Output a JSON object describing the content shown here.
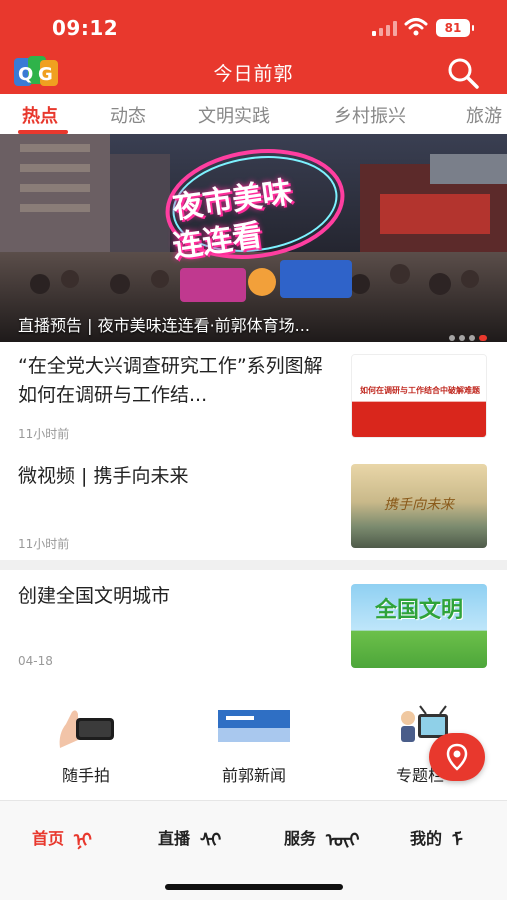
{
  "status_bar": {
    "time": "09:12",
    "battery": "81"
  },
  "header": {
    "title": "今日前郭",
    "logo_icon": "qg-logo-icon",
    "search_icon": "search-icon"
  },
  "tabs": [
    {
      "label": "热点",
      "active": true
    },
    {
      "label": "动态"
    },
    {
      "label": "文明实践"
    },
    {
      "label": "乡村振兴"
    },
    {
      "label": "旅游"
    }
  ],
  "banner": {
    "caption": "直播预告 | 夜市美味连连看·前郭体育场...",
    "overlay_line1": "夜市美味",
    "overlay_line2": "连连看"
  },
  "news": [
    {
      "title": "“在全党大兴调查研究工作”系列图解 如何在调研与工作结...",
      "time": "11小时前",
      "thumb_text": "如何在调研与工作结合中破解难题"
    },
    {
      "title": "微视频 | 携手向未来",
      "time": "11小时前",
      "thumb_text": "携手向未来"
    },
    {
      "title": "创建全国文明城市",
      "time": "04-18",
      "thumb_text": "全国文明"
    }
  ],
  "shortcuts": [
    {
      "label": "随手拍",
      "icon": "phone-hand-icon"
    },
    {
      "label": "前郭新闻",
      "icon": "news-banner-icon"
    },
    {
      "label": "专题栏",
      "icon": "tv-icon"
    }
  ],
  "fab": {
    "icon": "location-pin-icon"
  },
  "bottom_nav": [
    {
      "label": "首页",
      "active": true
    },
    {
      "label": "直播"
    },
    {
      "label": "服务"
    },
    {
      "label": "我的"
    }
  ],
  "colors": {
    "brand": "#e8382d"
  }
}
